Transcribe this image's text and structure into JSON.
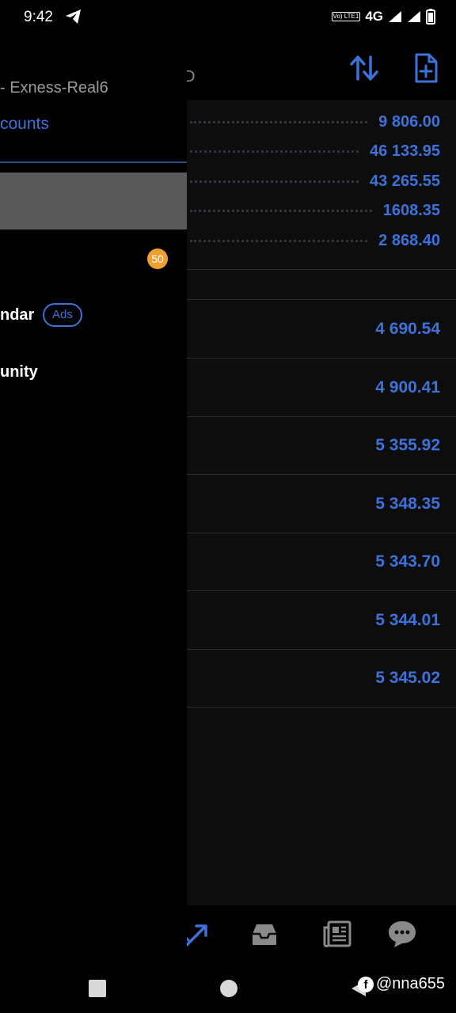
{
  "status_bar": {
    "time": "9:42",
    "volte_label": "Vo) LTE1",
    "network_label": "4G",
    "icons": [
      "telegram-icon",
      "signal-icon",
      "signal-icon",
      "battery-icon"
    ]
  },
  "header": {
    "title_fragment": "D",
    "actions": [
      "sort-icon",
      "new-document-icon"
    ]
  },
  "summary": {
    "values": [
      "9 806.00",
      "46 133.95",
      "43 265.55",
      "1608.35",
      "2 868.40"
    ]
  },
  "deals": {
    "values": [
      "4 690.54",
      "4 900.41",
      "5 355.92",
      "5 348.35",
      "5 343.70",
      "5 344.01",
      "5 345.02"
    ]
  },
  "drawer": {
    "server_text": "- Exness-Real6",
    "accounts_link": "counts",
    "badge_count": "50",
    "calendar_label": "ndar",
    "ads_label": "Ads",
    "community_label": "unity"
  },
  "bottom_nav": {
    "icons": [
      "trade-icon",
      "mailbox-icon",
      "news-icon",
      "chat-icon"
    ]
  },
  "system_nav": {
    "icons": [
      "recents-icon",
      "home-icon",
      "back-icon"
    ]
  },
  "watermark": {
    "text": "@nna655",
    "icon": "facebook-icon"
  },
  "colors": {
    "accent": "#3d72d9",
    "badge": "#f0a030",
    "background": "#0d0d0d",
    "drawer_background": "#000000",
    "selected_item": "#595959"
  }
}
